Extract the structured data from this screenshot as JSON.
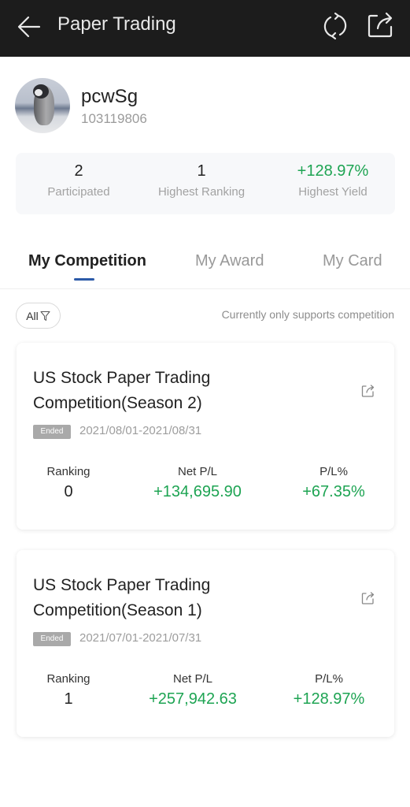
{
  "header": {
    "title": "Paper Trading",
    "icons": [
      "back-arrow-icon",
      "refresh-icon",
      "share-icon"
    ]
  },
  "profile": {
    "username": "pcwSg",
    "user_id": "103119806"
  },
  "stats": [
    {
      "value": "2",
      "label": "Participated",
      "positive": false
    },
    {
      "value": "1",
      "label": "Highest Ranking",
      "positive": false
    },
    {
      "value": "+128.97%",
      "label": "Highest Yield",
      "positive": true
    }
  ],
  "tabs": [
    {
      "label": "My Competition",
      "active": true
    },
    {
      "label": "My Award",
      "active": false
    },
    {
      "label": "My Card",
      "active": false
    }
  ],
  "filter": {
    "label": "All",
    "note": "Currently only supports competition"
  },
  "colors": {
    "positive": "#1ea453",
    "accent": "#2c5aa8",
    "topbar": "#1c1c1c"
  },
  "competitions": [
    {
      "title": "US Stock Paper Trading Competition(Season 2)",
      "status": "Ended",
      "dates": "2021/08/01-2021/08/31",
      "ranking_label": "Ranking",
      "ranking": "0",
      "net_pl_label": "Net P/L",
      "net_pl": "+134,695.90",
      "pl_pct_label": "P/L%",
      "pl_pct": "+67.35%"
    },
    {
      "title": "US Stock Paper Trading Competition(Season 1)",
      "status": "Ended",
      "dates": "2021/07/01-2021/07/31",
      "ranking_label": "Ranking",
      "ranking": "1",
      "net_pl_label": "Net P/L",
      "net_pl": "+257,942.63",
      "pl_pct_label": "P/L%",
      "pl_pct": "+128.97%"
    }
  ]
}
